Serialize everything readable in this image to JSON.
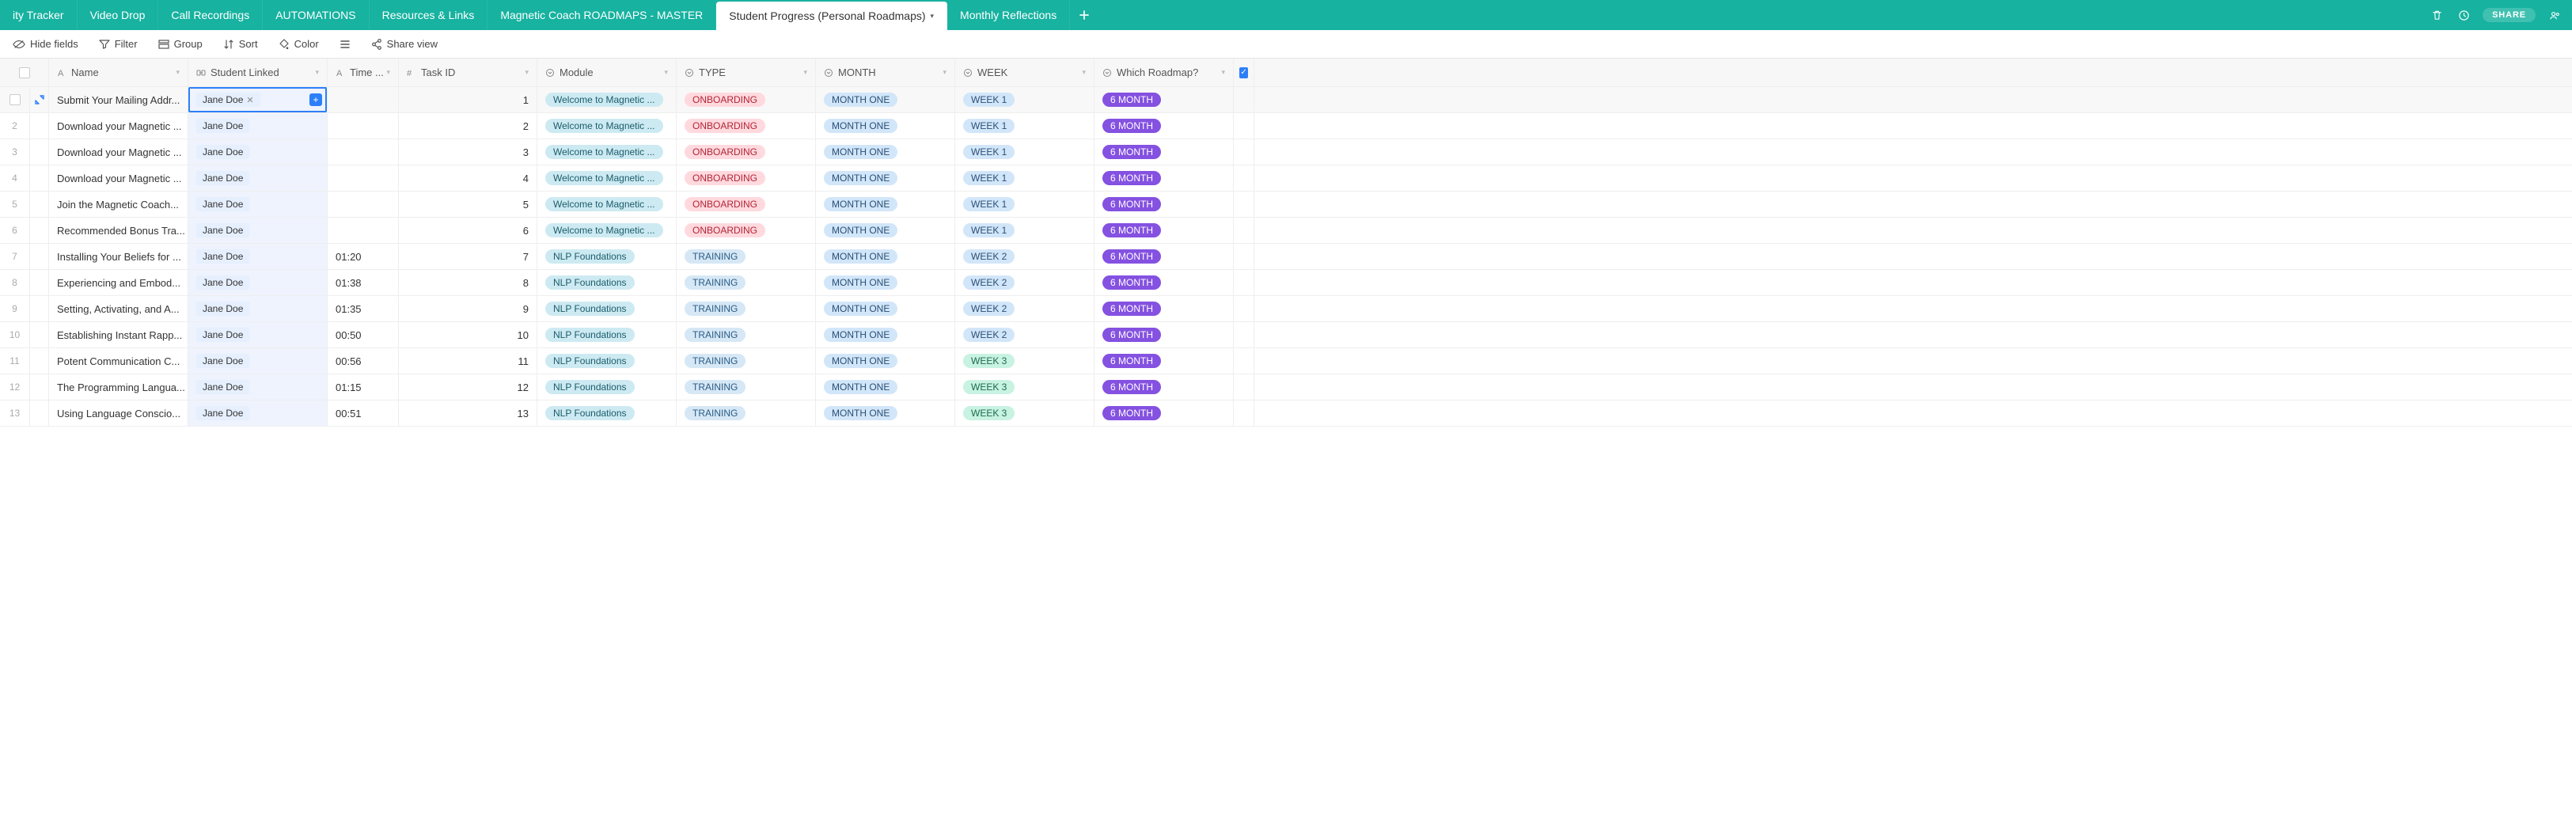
{
  "tabs": {
    "items": [
      {
        "label": "ity Tracker"
      },
      {
        "label": "Video Drop"
      },
      {
        "label": "Call Recordings"
      },
      {
        "label": "AUTOMATIONS"
      },
      {
        "label": "Resources & Links"
      },
      {
        "label": "Magnetic Coach ROADMAPS - MASTER"
      },
      {
        "label": "Student Progress (Personal Roadmaps)",
        "active": true
      },
      {
        "label": "Monthly Reflections"
      }
    ],
    "share_label": "SHARE"
  },
  "toolbar": {
    "hide_fields": "Hide fields",
    "filter": "Filter",
    "group": "Group",
    "sort": "Sort",
    "color": "Color",
    "share_view": "Share view"
  },
  "columns": {
    "name": "Name",
    "student": "Student Linked",
    "time": "Time ...",
    "task": "Task ID",
    "module": "Module",
    "type": "TYPE",
    "month": "MONTH",
    "week": "WEEK",
    "roadmap": "Which Roadmap?"
  },
  "rows": [
    {
      "num": "",
      "name": "Submit Your Mailing Addr...",
      "student": "Jane Doe",
      "time": "",
      "task": "1",
      "module": "Welcome to Magnetic ...",
      "type": "ONBOARDING",
      "month": "MONTH ONE",
      "week": "WEEK 1",
      "week_class": "week1",
      "roadmap": "6 MONTH",
      "selected": true,
      "chip_x": true
    },
    {
      "num": "2",
      "name": "Download your Magnetic ...",
      "student": "Jane Doe",
      "time": "",
      "task": "2",
      "module": "Welcome to Magnetic ...",
      "type": "ONBOARDING",
      "month": "MONTH ONE",
      "week": "WEEK 1",
      "week_class": "week1",
      "roadmap": "6 MONTH"
    },
    {
      "num": "3",
      "name": "Download your Magnetic ...",
      "student": "Jane Doe",
      "time": "",
      "task": "3",
      "module": "Welcome to Magnetic ...",
      "type": "ONBOARDING",
      "month": "MONTH ONE",
      "week": "WEEK 1",
      "week_class": "week1",
      "roadmap": "6 MONTH"
    },
    {
      "num": "4",
      "name": "Download your Magnetic ...",
      "student": "Jane Doe",
      "time": "",
      "task": "4",
      "module": "Welcome to Magnetic ...",
      "type": "ONBOARDING",
      "month": "MONTH ONE",
      "week": "WEEK 1",
      "week_class": "week1",
      "roadmap": "6 MONTH"
    },
    {
      "num": "5",
      "name": "Join the Magnetic Coach...",
      "student": "Jane Doe",
      "time": "",
      "task": "5",
      "module": "Welcome to Magnetic ...",
      "type": "ONBOARDING",
      "month": "MONTH ONE",
      "week": "WEEK 1",
      "week_class": "week1",
      "roadmap": "6 MONTH"
    },
    {
      "num": "6",
      "name": "Recommended Bonus Tra...",
      "student": "Jane Doe",
      "time": "",
      "task": "6",
      "module": "Welcome to Magnetic ...",
      "type": "ONBOARDING",
      "month": "MONTH ONE",
      "week": "WEEK 1",
      "week_class": "week1",
      "roadmap": "6 MONTH"
    },
    {
      "num": "7",
      "name": "Installing Your Beliefs for ...",
      "student": "Jane Doe",
      "time": "01:20",
      "task": "7",
      "module": "NLP Foundations",
      "type": "TRAINING",
      "month": "MONTH ONE",
      "week": "WEEK 2",
      "week_class": "week2",
      "roadmap": "6 MONTH"
    },
    {
      "num": "8",
      "name": "Experiencing and Embod...",
      "student": "Jane Doe",
      "time": "01:38",
      "task": "8",
      "module": "NLP Foundations",
      "type": "TRAINING",
      "month": "MONTH ONE",
      "week": "WEEK 2",
      "week_class": "week2",
      "roadmap": "6 MONTH"
    },
    {
      "num": "9",
      "name": "Setting, Activating, and A...",
      "student": "Jane Doe",
      "time": "01:35",
      "task": "9",
      "module": "NLP Foundations",
      "type": "TRAINING",
      "month": "MONTH ONE",
      "week": "WEEK 2",
      "week_class": "week2",
      "roadmap": "6 MONTH"
    },
    {
      "num": "10",
      "name": "Establishing Instant Rapp...",
      "student": "Jane Doe",
      "time": "00:50",
      "task": "10",
      "module": "NLP Foundations",
      "type": "TRAINING",
      "month": "MONTH ONE",
      "week": "WEEK 2",
      "week_class": "week2",
      "roadmap": "6 MONTH"
    },
    {
      "num": "11",
      "name": "Potent Communication C...",
      "student": "Jane Doe",
      "time": "00:56",
      "task": "11",
      "module": "NLP Foundations",
      "type": "TRAINING",
      "month": "MONTH ONE",
      "week": "WEEK 3",
      "week_class": "week3",
      "roadmap": "6 MONTH"
    },
    {
      "num": "12",
      "name": "The Programming Langua...",
      "student": "Jane Doe",
      "time": "01:15",
      "task": "12",
      "module": "NLP Foundations",
      "type": "TRAINING",
      "month": "MONTH ONE",
      "week": "WEEK 3",
      "week_class": "week3",
      "roadmap": "6 MONTH"
    },
    {
      "num": "13",
      "name": "Using Language Conscio...",
      "student": "Jane Doe",
      "time": "00:51",
      "task": "13",
      "module": "NLP Foundations",
      "type": "TRAINING",
      "month": "MONTH ONE",
      "week": "WEEK 3",
      "week_class": "week3",
      "roadmap": "6 MONTH"
    }
  ]
}
